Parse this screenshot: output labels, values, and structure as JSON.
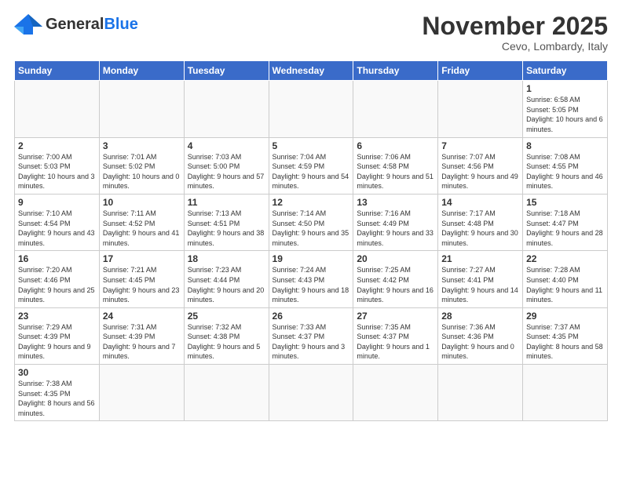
{
  "header": {
    "logo_general": "General",
    "logo_blue": "Blue",
    "month_title": "November 2025",
    "subtitle": "Cevo, Lombardy, Italy"
  },
  "weekdays": [
    "Sunday",
    "Monday",
    "Tuesday",
    "Wednesday",
    "Thursday",
    "Friday",
    "Saturday"
  ],
  "weeks": [
    [
      {
        "day": "",
        "info": ""
      },
      {
        "day": "",
        "info": ""
      },
      {
        "day": "",
        "info": ""
      },
      {
        "day": "",
        "info": ""
      },
      {
        "day": "",
        "info": ""
      },
      {
        "day": "",
        "info": ""
      },
      {
        "day": "1",
        "info": "Sunrise: 6:58 AM\nSunset: 5:05 PM\nDaylight: 10 hours and 6 minutes."
      }
    ],
    [
      {
        "day": "2",
        "info": "Sunrise: 7:00 AM\nSunset: 5:03 PM\nDaylight: 10 hours and 3 minutes."
      },
      {
        "day": "3",
        "info": "Sunrise: 7:01 AM\nSunset: 5:02 PM\nDaylight: 10 hours and 0 minutes."
      },
      {
        "day": "4",
        "info": "Sunrise: 7:03 AM\nSunset: 5:00 PM\nDaylight: 9 hours and 57 minutes."
      },
      {
        "day": "5",
        "info": "Sunrise: 7:04 AM\nSunset: 4:59 PM\nDaylight: 9 hours and 54 minutes."
      },
      {
        "day": "6",
        "info": "Sunrise: 7:06 AM\nSunset: 4:58 PM\nDaylight: 9 hours and 51 minutes."
      },
      {
        "day": "7",
        "info": "Sunrise: 7:07 AM\nSunset: 4:56 PM\nDaylight: 9 hours and 49 minutes."
      },
      {
        "day": "8",
        "info": "Sunrise: 7:08 AM\nSunset: 4:55 PM\nDaylight: 9 hours and 46 minutes."
      }
    ],
    [
      {
        "day": "9",
        "info": "Sunrise: 7:10 AM\nSunset: 4:54 PM\nDaylight: 9 hours and 43 minutes."
      },
      {
        "day": "10",
        "info": "Sunrise: 7:11 AM\nSunset: 4:52 PM\nDaylight: 9 hours and 41 minutes."
      },
      {
        "day": "11",
        "info": "Sunrise: 7:13 AM\nSunset: 4:51 PM\nDaylight: 9 hours and 38 minutes."
      },
      {
        "day": "12",
        "info": "Sunrise: 7:14 AM\nSunset: 4:50 PM\nDaylight: 9 hours and 35 minutes."
      },
      {
        "day": "13",
        "info": "Sunrise: 7:16 AM\nSunset: 4:49 PM\nDaylight: 9 hours and 33 minutes."
      },
      {
        "day": "14",
        "info": "Sunrise: 7:17 AM\nSunset: 4:48 PM\nDaylight: 9 hours and 30 minutes."
      },
      {
        "day": "15",
        "info": "Sunrise: 7:18 AM\nSunset: 4:47 PM\nDaylight: 9 hours and 28 minutes."
      }
    ],
    [
      {
        "day": "16",
        "info": "Sunrise: 7:20 AM\nSunset: 4:46 PM\nDaylight: 9 hours and 25 minutes."
      },
      {
        "day": "17",
        "info": "Sunrise: 7:21 AM\nSunset: 4:45 PM\nDaylight: 9 hours and 23 minutes."
      },
      {
        "day": "18",
        "info": "Sunrise: 7:23 AM\nSunset: 4:44 PM\nDaylight: 9 hours and 20 minutes."
      },
      {
        "day": "19",
        "info": "Sunrise: 7:24 AM\nSunset: 4:43 PM\nDaylight: 9 hours and 18 minutes."
      },
      {
        "day": "20",
        "info": "Sunrise: 7:25 AM\nSunset: 4:42 PM\nDaylight: 9 hours and 16 minutes."
      },
      {
        "day": "21",
        "info": "Sunrise: 7:27 AM\nSunset: 4:41 PM\nDaylight: 9 hours and 14 minutes."
      },
      {
        "day": "22",
        "info": "Sunrise: 7:28 AM\nSunset: 4:40 PM\nDaylight: 9 hours and 11 minutes."
      }
    ],
    [
      {
        "day": "23",
        "info": "Sunrise: 7:29 AM\nSunset: 4:39 PM\nDaylight: 9 hours and 9 minutes."
      },
      {
        "day": "24",
        "info": "Sunrise: 7:31 AM\nSunset: 4:39 PM\nDaylight: 9 hours and 7 minutes."
      },
      {
        "day": "25",
        "info": "Sunrise: 7:32 AM\nSunset: 4:38 PM\nDaylight: 9 hours and 5 minutes."
      },
      {
        "day": "26",
        "info": "Sunrise: 7:33 AM\nSunset: 4:37 PM\nDaylight: 9 hours and 3 minutes."
      },
      {
        "day": "27",
        "info": "Sunrise: 7:35 AM\nSunset: 4:37 PM\nDaylight: 9 hours and 1 minute."
      },
      {
        "day": "28",
        "info": "Sunrise: 7:36 AM\nSunset: 4:36 PM\nDaylight: 9 hours and 0 minutes."
      },
      {
        "day": "29",
        "info": "Sunrise: 7:37 AM\nSunset: 4:35 PM\nDaylight: 8 hours and 58 minutes."
      }
    ],
    [
      {
        "day": "30",
        "info": "Sunrise: 7:38 AM\nSunset: 4:35 PM\nDaylight: 8 hours and 56 minutes."
      },
      {
        "day": "",
        "info": ""
      },
      {
        "day": "",
        "info": ""
      },
      {
        "day": "",
        "info": ""
      },
      {
        "day": "",
        "info": ""
      },
      {
        "day": "",
        "info": ""
      },
      {
        "day": "",
        "info": ""
      }
    ]
  ]
}
